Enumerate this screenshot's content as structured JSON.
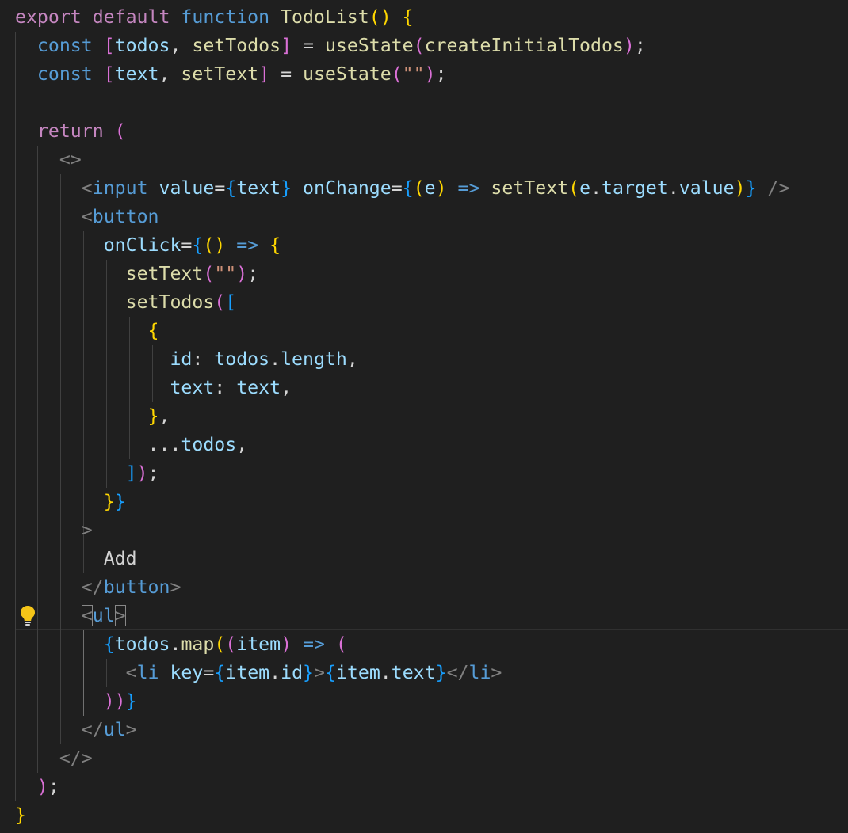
{
  "editor": {
    "language": "jsx",
    "theme_colors": {
      "background": "#1f1f1f",
      "keyword": "#c586c0",
      "storage": "#569cd6",
      "function": "#dcdcaa",
      "variable": "#9cdcfe",
      "string": "#ce9178",
      "punctuation": "#d4d4d4",
      "angle_bracket": "#808080",
      "bracket_level_1": "#ffd700",
      "bracket_level_2": "#da70d6",
      "bracket_level_3": "#179fff"
    },
    "current_line": 22,
    "gutter_icon": "lightbulb-icon",
    "lines": [
      [
        [
          "export default ",
          "kw"
        ],
        [
          "function ",
          "st"
        ],
        [
          "TodoList",
          "fn"
        ],
        [
          "()",
          "b1"
        ],
        [
          " ",
          "pun"
        ],
        [
          "{",
          "b1"
        ]
      ],
      [
        [
          "  ",
          "pun"
        ],
        [
          "const ",
          "st"
        ],
        [
          "[",
          "b2"
        ],
        [
          "todos",
          "var"
        ],
        [
          ", ",
          "pun"
        ],
        [
          "setTodos",
          "fn"
        ],
        [
          "]",
          "b2"
        ],
        [
          " = ",
          "pun"
        ],
        [
          "useState",
          "fn"
        ],
        [
          "(",
          "b2"
        ],
        [
          "createInitialTodos",
          "fn"
        ],
        [
          ")",
          "b2"
        ],
        [
          ";",
          "pun"
        ]
      ],
      [
        [
          "  ",
          "pun"
        ],
        [
          "const ",
          "st"
        ],
        [
          "[",
          "b2"
        ],
        [
          "text",
          "var"
        ],
        [
          ", ",
          "pun"
        ],
        [
          "setText",
          "fn"
        ],
        [
          "]",
          "b2"
        ],
        [
          " = ",
          "pun"
        ],
        [
          "useState",
          "fn"
        ],
        [
          "(",
          "b2"
        ],
        [
          "\"\"",
          "str"
        ],
        [
          ")",
          "b2"
        ],
        [
          ";",
          "pun"
        ]
      ],
      [],
      [
        [
          "  ",
          "pun"
        ],
        [
          "return ",
          "kw"
        ],
        [
          "(",
          "b2"
        ]
      ],
      [
        [
          "    ",
          "pun"
        ],
        [
          "<>",
          "ang"
        ]
      ],
      [
        [
          "      ",
          "pun"
        ],
        [
          "<",
          "ang"
        ],
        [
          "input ",
          "tag"
        ],
        [
          "value",
          "attr"
        ],
        [
          "=",
          "pun"
        ],
        [
          "{",
          "b3"
        ],
        [
          "text",
          "var"
        ],
        [
          "}",
          "b3"
        ],
        [
          " ",
          "pun"
        ],
        [
          "onChange",
          "attr"
        ],
        [
          "=",
          "pun"
        ],
        [
          "{",
          "b3"
        ],
        [
          "(",
          "b1"
        ],
        [
          "e",
          "var"
        ],
        [
          ")",
          "b1"
        ],
        [
          " => ",
          "st"
        ],
        [
          "setText",
          "fn"
        ],
        [
          "(",
          "b1"
        ],
        [
          "e",
          "var"
        ],
        [
          ".",
          "pun"
        ],
        [
          "target",
          "var"
        ],
        [
          ".",
          "pun"
        ],
        [
          "value",
          "var"
        ],
        [
          ")",
          "b1"
        ],
        [
          "}",
          "b3"
        ],
        [
          " />",
          "ang"
        ]
      ],
      [
        [
          "      ",
          "pun"
        ],
        [
          "<",
          "ang"
        ],
        [
          "button",
          "tag"
        ]
      ],
      [
        [
          "        ",
          "pun"
        ],
        [
          "onClick",
          "attr"
        ],
        [
          "=",
          "pun"
        ],
        [
          "{",
          "b3"
        ],
        [
          "()",
          "b1"
        ],
        [
          " => ",
          "st"
        ],
        [
          "{",
          "b1"
        ]
      ],
      [
        [
          "          ",
          "pun"
        ],
        [
          "setText",
          "fn"
        ],
        [
          "(",
          "b2"
        ],
        [
          "\"\"",
          "str"
        ],
        [
          ")",
          "b2"
        ],
        [
          ";",
          "pun"
        ]
      ],
      [
        [
          "          ",
          "pun"
        ],
        [
          "setTodos",
          "fn"
        ],
        [
          "(",
          "b2"
        ],
        [
          "[",
          "b3"
        ]
      ],
      [
        [
          "            ",
          "pun"
        ],
        [
          "{",
          "b1"
        ]
      ],
      [
        [
          "              ",
          "pun"
        ],
        [
          "id",
          "var"
        ],
        [
          ": ",
          "pun"
        ],
        [
          "todos",
          "var"
        ],
        [
          ".",
          "pun"
        ],
        [
          "length",
          "var"
        ],
        [
          ",",
          "pun"
        ]
      ],
      [
        [
          "              ",
          "pun"
        ],
        [
          "text",
          "var"
        ],
        [
          ": ",
          "pun"
        ],
        [
          "text",
          "var"
        ],
        [
          ",",
          "pun"
        ]
      ],
      [
        [
          "            ",
          "pun"
        ],
        [
          "}",
          "b1"
        ],
        [
          ",",
          "pun"
        ]
      ],
      [
        [
          "            ",
          "pun"
        ],
        [
          "...",
          "pun"
        ],
        [
          "todos",
          "var"
        ],
        [
          ",",
          "pun"
        ]
      ],
      [
        [
          "          ",
          "pun"
        ],
        [
          "]",
          "b3"
        ],
        [
          ")",
          "b2"
        ],
        [
          ";",
          "pun"
        ]
      ],
      [
        [
          "        ",
          "pun"
        ],
        [
          "}",
          "b1"
        ],
        [
          "}",
          "b3"
        ]
      ],
      [
        [
          "      ",
          "pun"
        ],
        [
          ">",
          "ang"
        ]
      ],
      [
        [
          "        ",
          "pun"
        ],
        [
          "Add",
          "pun"
        ]
      ],
      [
        [
          "      ",
          "pun"
        ],
        [
          "</",
          "ang"
        ],
        [
          "button",
          "tag"
        ],
        [
          ">",
          "ang"
        ]
      ],
      [
        [
          "      ",
          "pun"
        ],
        [
          "<",
          "ang"
        ],
        [
          "ul",
          "tag"
        ],
        [
          ">",
          "ang"
        ]
      ],
      [
        [
          "        ",
          "pun"
        ],
        [
          "{",
          "b3"
        ],
        [
          "todos",
          "var"
        ],
        [
          ".",
          "pun"
        ],
        [
          "map",
          "fn"
        ],
        [
          "(",
          "b1"
        ],
        [
          "(",
          "b2"
        ],
        [
          "item",
          "var"
        ],
        [
          ")",
          "b2"
        ],
        [
          " => ",
          "st"
        ],
        [
          "(",
          "b2"
        ]
      ],
      [
        [
          "          ",
          "pun"
        ],
        [
          "<",
          "ang"
        ],
        [
          "li ",
          "tag"
        ],
        [
          "key",
          "attr"
        ],
        [
          "=",
          "pun"
        ],
        [
          "{",
          "b3"
        ],
        [
          "item",
          "var"
        ],
        [
          ".",
          "pun"
        ],
        [
          "id",
          "var"
        ],
        [
          "}",
          "b3"
        ],
        [
          ">",
          "ang"
        ],
        [
          "{",
          "b3"
        ],
        [
          "item",
          "var"
        ],
        [
          ".",
          "pun"
        ],
        [
          "text",
          "var"
        ],
        [
          "}",
          "b3"
        ],
        [
          "</",
          "ang"
        ],
        [
          "li",
          "tag"
        ],
        [
          ">",
          "ang"
        ]
      ],
      [
        [
          "        ",
          "pun"
        ],
        [
          "))",
          "b2"
        ],
        [
          "}",
          "b3"
        ]
      ],
      [
        [
          "      ",
          "pun"
        ],
        [
          "</",
          "ang"
        ],
        [
          "ul",
          "tag"
        ],
        [
          ">",
          "ang"
        ]
      ],
      [
        [
          "    ",
          "pun"
        ],
        [
          "</>",
          "ang"
        ]
      ],
      [
        [
          "  ",
          "pun"
        ],
        [
          ")",
          "b2"
        ],
        [
          ";",
          "pun"
        ]
      ],
      [
        [
          "}",
          "b1"
        ]
      ]
    ]
  }
}
